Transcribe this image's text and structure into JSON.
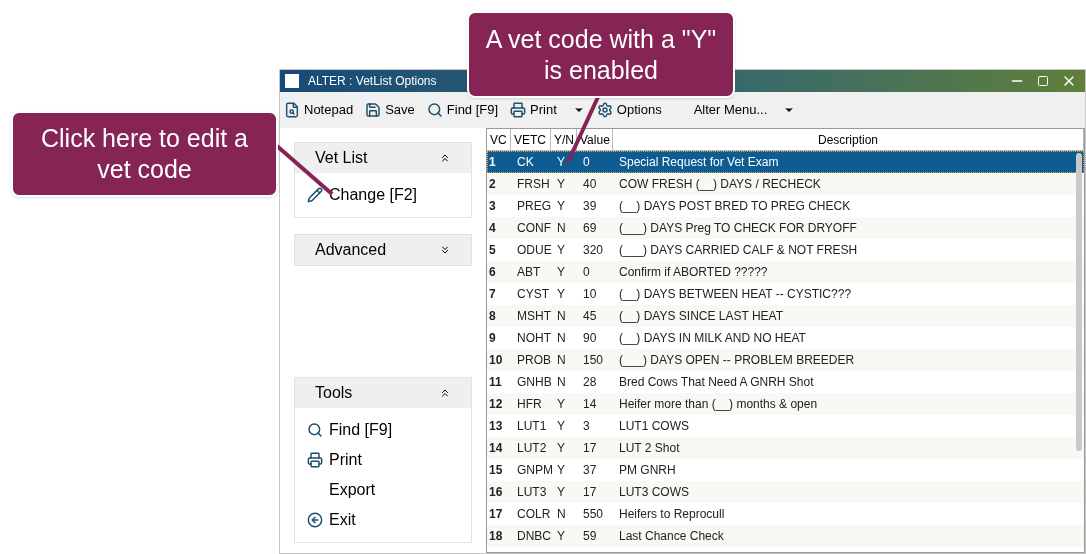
{
  "callouts": [
    {
      "text": "Click here to edit a vet code",
      "kind": "left"
    },
    {
      "text": "A vet code with a \"Y\" is enabled",
      "kind": "top"
    }
  ],
  "window": {
    "title": "ALTER : VetList Options"
  },
  "toolbar": [
    {
      "label": "Notepad",
      "kind": "notepad",
      "caret": false
    },
    {
      "label": "Save",
      "kind": "save",
      "caret": false
    },
    {
      "label": "Find [F9]",
      "kind": "search",
      "caret": false
    },
    {
      "label": "Print",
      "kind": "print",
      "caret": true
    },
    {
      "label": "Options",
      "kind": "gear",
      "caret": false
    },
    {
      "label": "Alter Menu...",
      "kind": "plain",
      "caret": true
    }
  ],
  "sidebar": [
    {
      "title": "Vet List",
      "expanded": true,
      "items": [
        {
          "label": "Change [F2]",
          "kind": "edit"
        }
      ]
    },
    {
      "title": "Advanced",
      "expanded": false
    },
    {
      "title": "Tools",
      "expanded": true,
      "items": [
        {
          "label": "Find [F9]",
          "kind": "search"
        },
        {
          "label": "Print",
          "kind": "print"
        },
        {
          "label": "Export",
          "kind": "plain"
        },
        {
          "label": "Exit",
          "kind": "exit"
        }
      ]
    }
  ],
  "table": {
    "columns": [
      "VC",
      "VETC",
      "Y/N",
      "Value",
      "Description"
    ],
    "rows": [
      {
        "cells": [
          "1",
          "CK",
          "Y",
          "0",
          "Special Request for Vet Exam"
        ],
        "selected": true
      },
      {
        "cells": [
          "2",
          "FRSH",
          "Y",
          "40",
          "COW FRESH (__) DAYS / RECHECK"
        ],
        "selected": false
      },
      {
        "cells": [
          "3",
          "PREG",
          "Y",
          "39",
          "(__) DAYS POST BRED TO PREG CHECK"
        ],
        "selected": false
      },
      {
        "cells": [
          "4",
          "CONF",
          "N",
          "69",
          "(___) DAYS Preg TO CHECK FOR DRYOFF"
        ],
        "selected": false
      },
      {
        "cells": [
          "5",
          "ODUE",
          "Y",
          "320",
          "(___) DAYS CARRIED CALF & NOT FRESH"
        ],
        "selected": false
      },
      {
        "cells": [
          "6",
          "ABT",
          "Y",
          "0",
          "Confirm if ABORTED ?????"
        ],
        "selected": false
      },
      {
        "cells": [
          "7",
          "CYST",
          "Y",
          "10",
          "(__) DAYS BETWEEN HEAT -- CYSTIC???"
        ],
        "selected": false
      },
      {
        "cells": [
          "8",
          "MSHT",
          "N",
          "45",
          "(__) DAYS SINCE LAST HEAT"
        ],
        "selected": false
      },
      {
        "cells": [
          "9",
          "NOHT",
          "N",
          "90",
          "(__) DAYS IN MILK AND NO HEAT"
        ],
        "selected": false
      },
      {
        "cells": [
          "10",
          "PROB",
          "N",
          "150",
          "(___) DAYS OPEN -- PROBLEM BREEDER"
        ],
        "selected": false
      },
      {
        "cells": [
          "11",
          "GNHB",
          "N",
          "28",
          "Bred Cows That Need A GNRH Shot"
        ],
        "selected": false
      },
      {
        "cells": [
          "12",
          "HFR",
          "Y",
          "14",
          "Heifer more than (__) months & open"
        ],
        "selected": false
      },
      {
        "cells": [
          "13",
          "LUT1",
          "Y",
          "3",
          "LUT1 COWS"
        ],
        "selected": false
      },
      {
        "cells": [
          "14",
          "LUT2",
          "Y",
          "17",
          "LUT 2 Shot"
        ],
        "selected": false
      },
      {
        "cells": [
          "15",
          "GNPM",
          "Y",
          "37",
          "PM GNRH"
        ],
        "selected": false
      },
      {
        "cells": [
          "16",
          "LUT3",
          "Y",
          "17",
          "LUT3 COWS"
        ],
        "selected": false
      },
      {
        "cells": [
          "17",
          "COLR",
          "N",
          "550",
          "Heifers to Reprocull"
        ],
        "selected": false
      },
      {
        "cells": [
          "18",
          "DNBC",
          "Y",
          "59",
          "Last Chance Check"
        ],
        "selected": false
      }
    ]
  }
}
